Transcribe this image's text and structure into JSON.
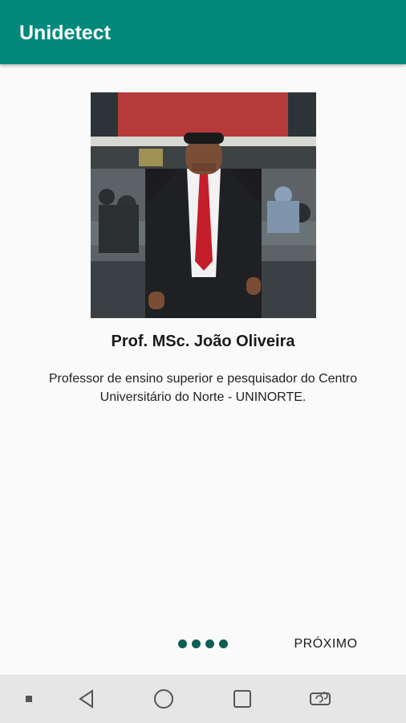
{
  "app_bar": {
    "title": "Unidetect",
    "color": "#00897b"
  },
  "slide": {
    "photo_icon": "profile-photo",
    "name": "Prof. MSc. João Oliveira",
    "description": "Professor de ensino superior e pesquisador do Centro Universitário do Norte - UNINORTE."
  },
  "pager": {
    "total_pages": 4,
    "dot_color": "#0d5e55"
  },
  "footer": {
    "next_label": "PRÓXIMO"
  },
  "nav_bar": {
    "buttons": [
      "square-small-icon",
      "back-icon",
      "home-icon",
      "recents-icon",
      "rotate-icon"
    ]
  }
}
